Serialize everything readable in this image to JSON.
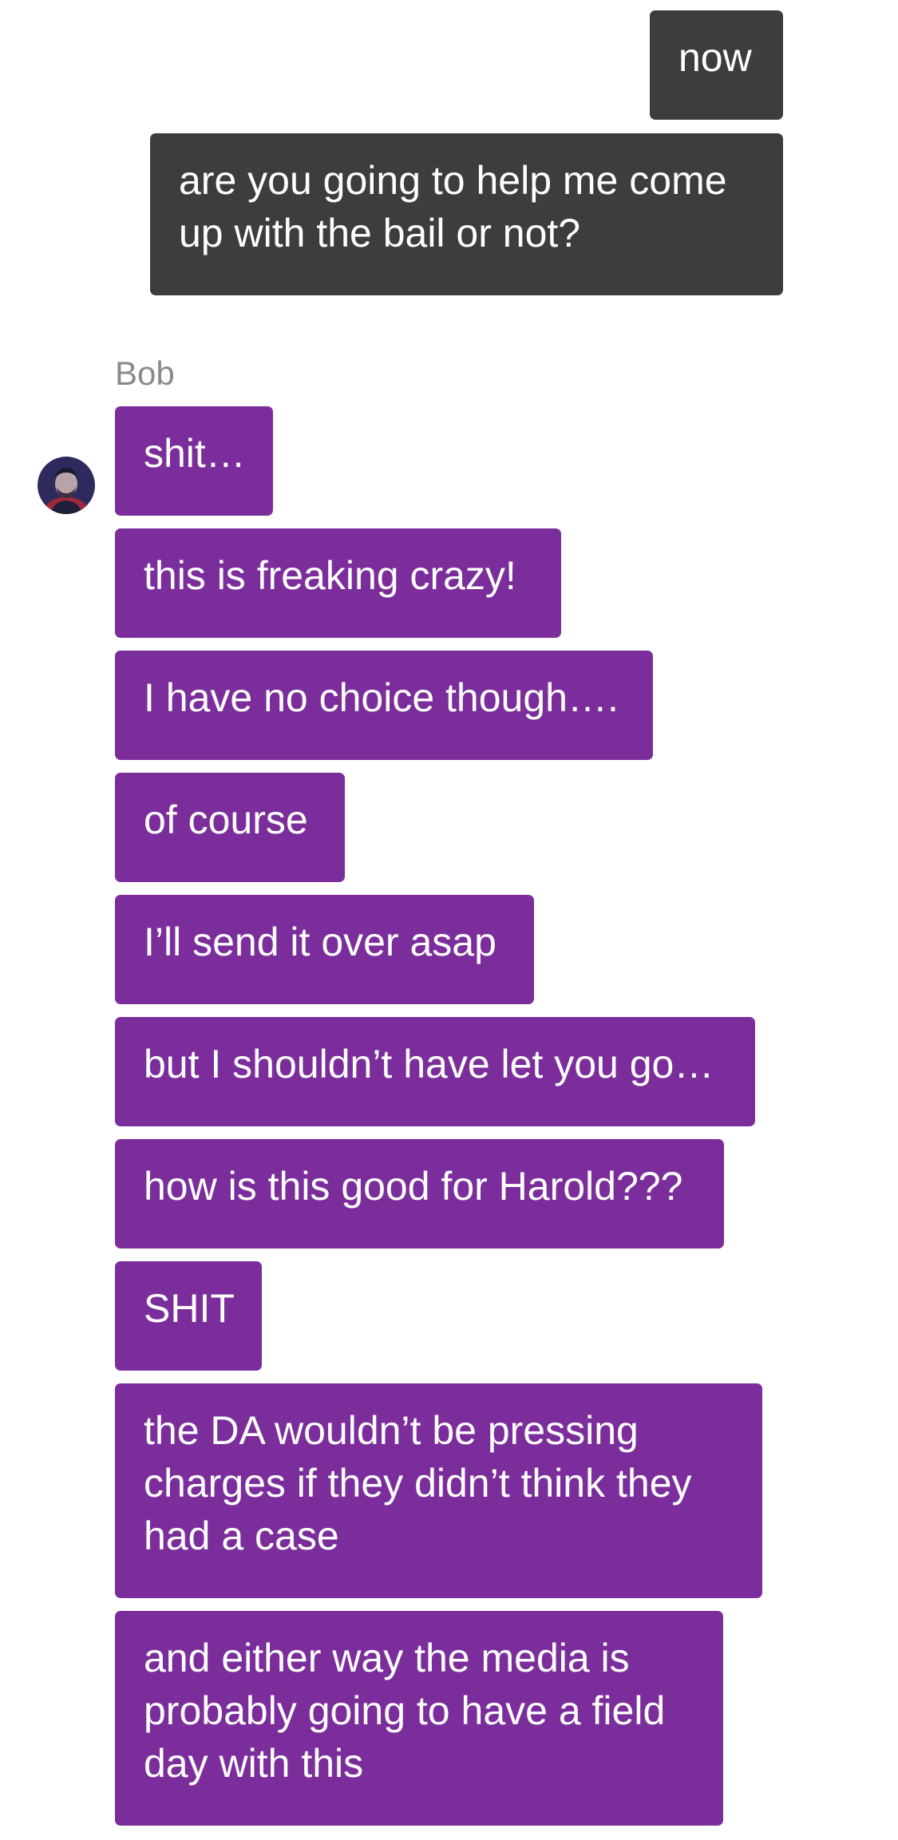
{
  "sent_messages": [
    {
      "text": "now"
    },
    {
      "text": "are you going to help me come up with the bail or not?"
    }
  ],
  "sender": {
    "name": "Bob",
    "avatar_icon": "person-photo-avatar"
  },
  "received_messages": [
    {
      "text": "shit…"
    },
    {
      "text": "this is freaking crazy!"
    },
    {
      "text": "I have no choice though…."
    },
    {
      "text": "of course"
    },
    {
      "text": "I’ll send it over asap"
    },
    {
      "text": "but I shouldn’t have let you go…"
    },
    {
      "text": "how is this good for Harold???"
    },
    {
      "text": "SHIT"
    },
    {
      "text": "the DA wouldn’t be pressing charges if they didn’t think they had a case"
    },
    {
      "text": "and either way the media is probably going to have a field day with this"
    }
  ],
  "colors": {
    "sent_bubble": "#3d3d3d",
    "received_bubble": "#7b2e9b",
    "sender_name": "#8a8a8a",
    "background": "#ffffff"
  }
}
